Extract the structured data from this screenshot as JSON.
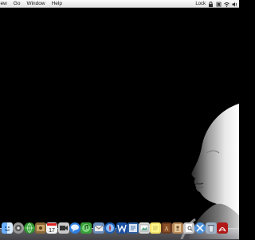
{
  "menubar": {
    "items": [
      "iew",
      "Go",
      "Window",
      "Help"
    ],
    "lock_label": "Lock"
  },
  "dock": {
    "icons": [
      "finder-icon",
      "system-preferences-icon",
      "network-globe-icon",
      "photo-icon",
      "calendar-icon",
      "video-icon",
      "ichat-icon",
      "itunes-icon",
      "mail-icon",
      "safari-icon",
      "textedit-icon",
      "office-icon",
      "image-viewer-icon",
      "stickies-icon",
      "dictionary-icon",
      "address-book-icon",
      "preview-icon",
      "tools-icon",
      "trash-icon",
      "acrobat-icon"
    ]
  }
}
